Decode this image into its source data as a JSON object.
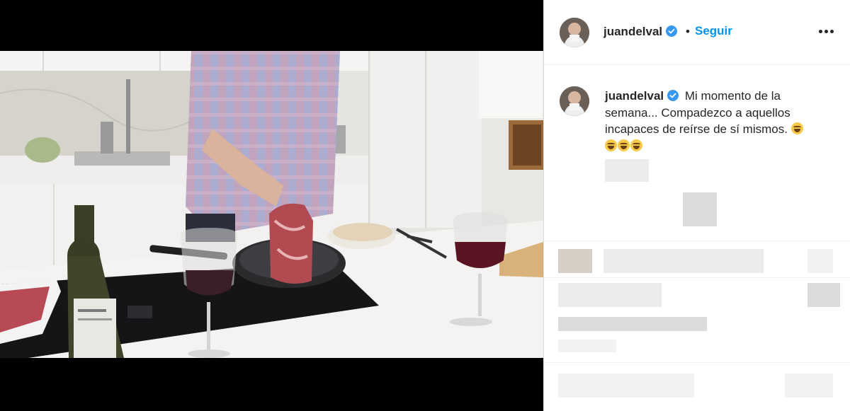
{
  "post": {
    "username": "juandelval",
    "follow_label": "Seguir",
    "separator": "•",
    "caption": "Mi momento de la semana... Compadezco a aquellos incapaces de reírse de sí mismos.",
    "caption_emojis": [
      "face-with-tears-of-joy",
      "face-with-tears-of-joy",
      "face-with-tears-of-joy",
      "face-with-tears-of-joy"
    ]
  },
  "icons": {
    "verified": "verified-badge-icon",
    "more": "more-options-icon",
    "mute": "muted-speaker-icon"
  },
  "colors": {
    "accent": "#0095f6",
    "verified": "#3897f0",
    "text": "#262626",
    "border": "#dbdbdb"
  }
}
